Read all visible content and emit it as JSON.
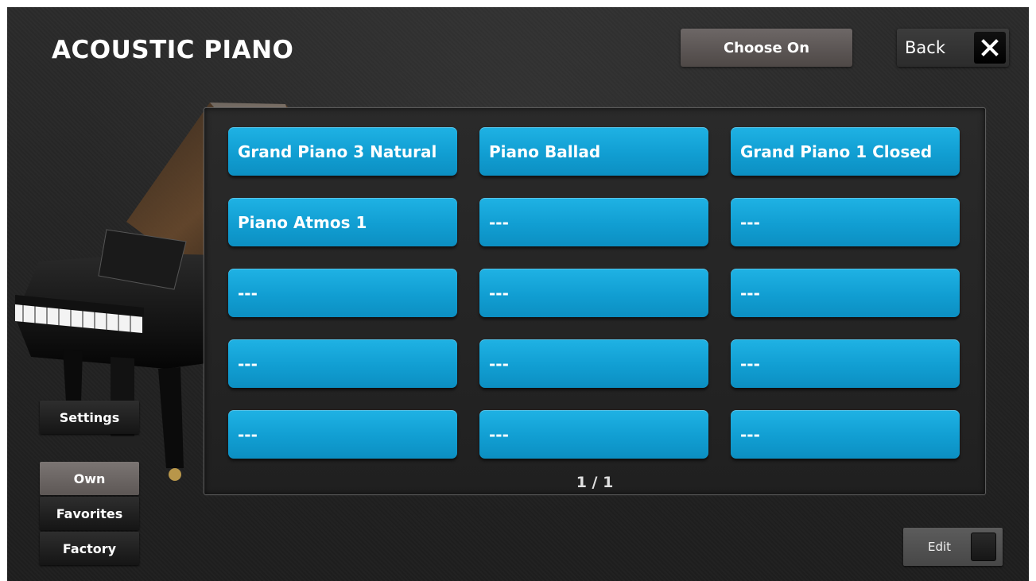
{
  "header": {
    "title": "ACOUSTIC PIANO",
    "choose_on_label": "Choose On",
    "back_label": "Back"
  },
  "presets": [
    {
      "label": "Grand Piano 3 Natural"
    },
    {
      "label": "Piano Ballad"
    },
    {
      "label": "Grand Piano 1 Closed"
    },
    {
      "label": "Piano Atmos  1"
    },
    {
      "label": "---"
    },
    {
      "label": "---"
    },
    {
      "label": "---"
    },
    {
      "label": "---"
    },
    {
      "label": "---"
    },
    {
      "label": "---"
    },
    {
      "label": "---"
    },
    {
      "label": "---"
    },
    {
      "label": "---"
    },
    {
      "label": "---"
    },
    {
      "label": "---"
    }
  ],
  "page_indicator": "1 / 1",
  "sidebar": {
    "settings_label": "Settings",
    "own_label": "Own",
    "favorites_label": "Favorites",
    "factory_label": "Factory",
    "selected": "Own"
  },
  "footer": {
    "edit_label": "Edit",
    "edit_on": false
  },
  "colors": {
    "preset_blue": "#16a6d9",
    "background": "#252525",
    "selected_tab": "#6b6563"
  },
  "icons": {
    "close": "close-icon",
    "illustration": "grand-piano-icon"
  }
}
